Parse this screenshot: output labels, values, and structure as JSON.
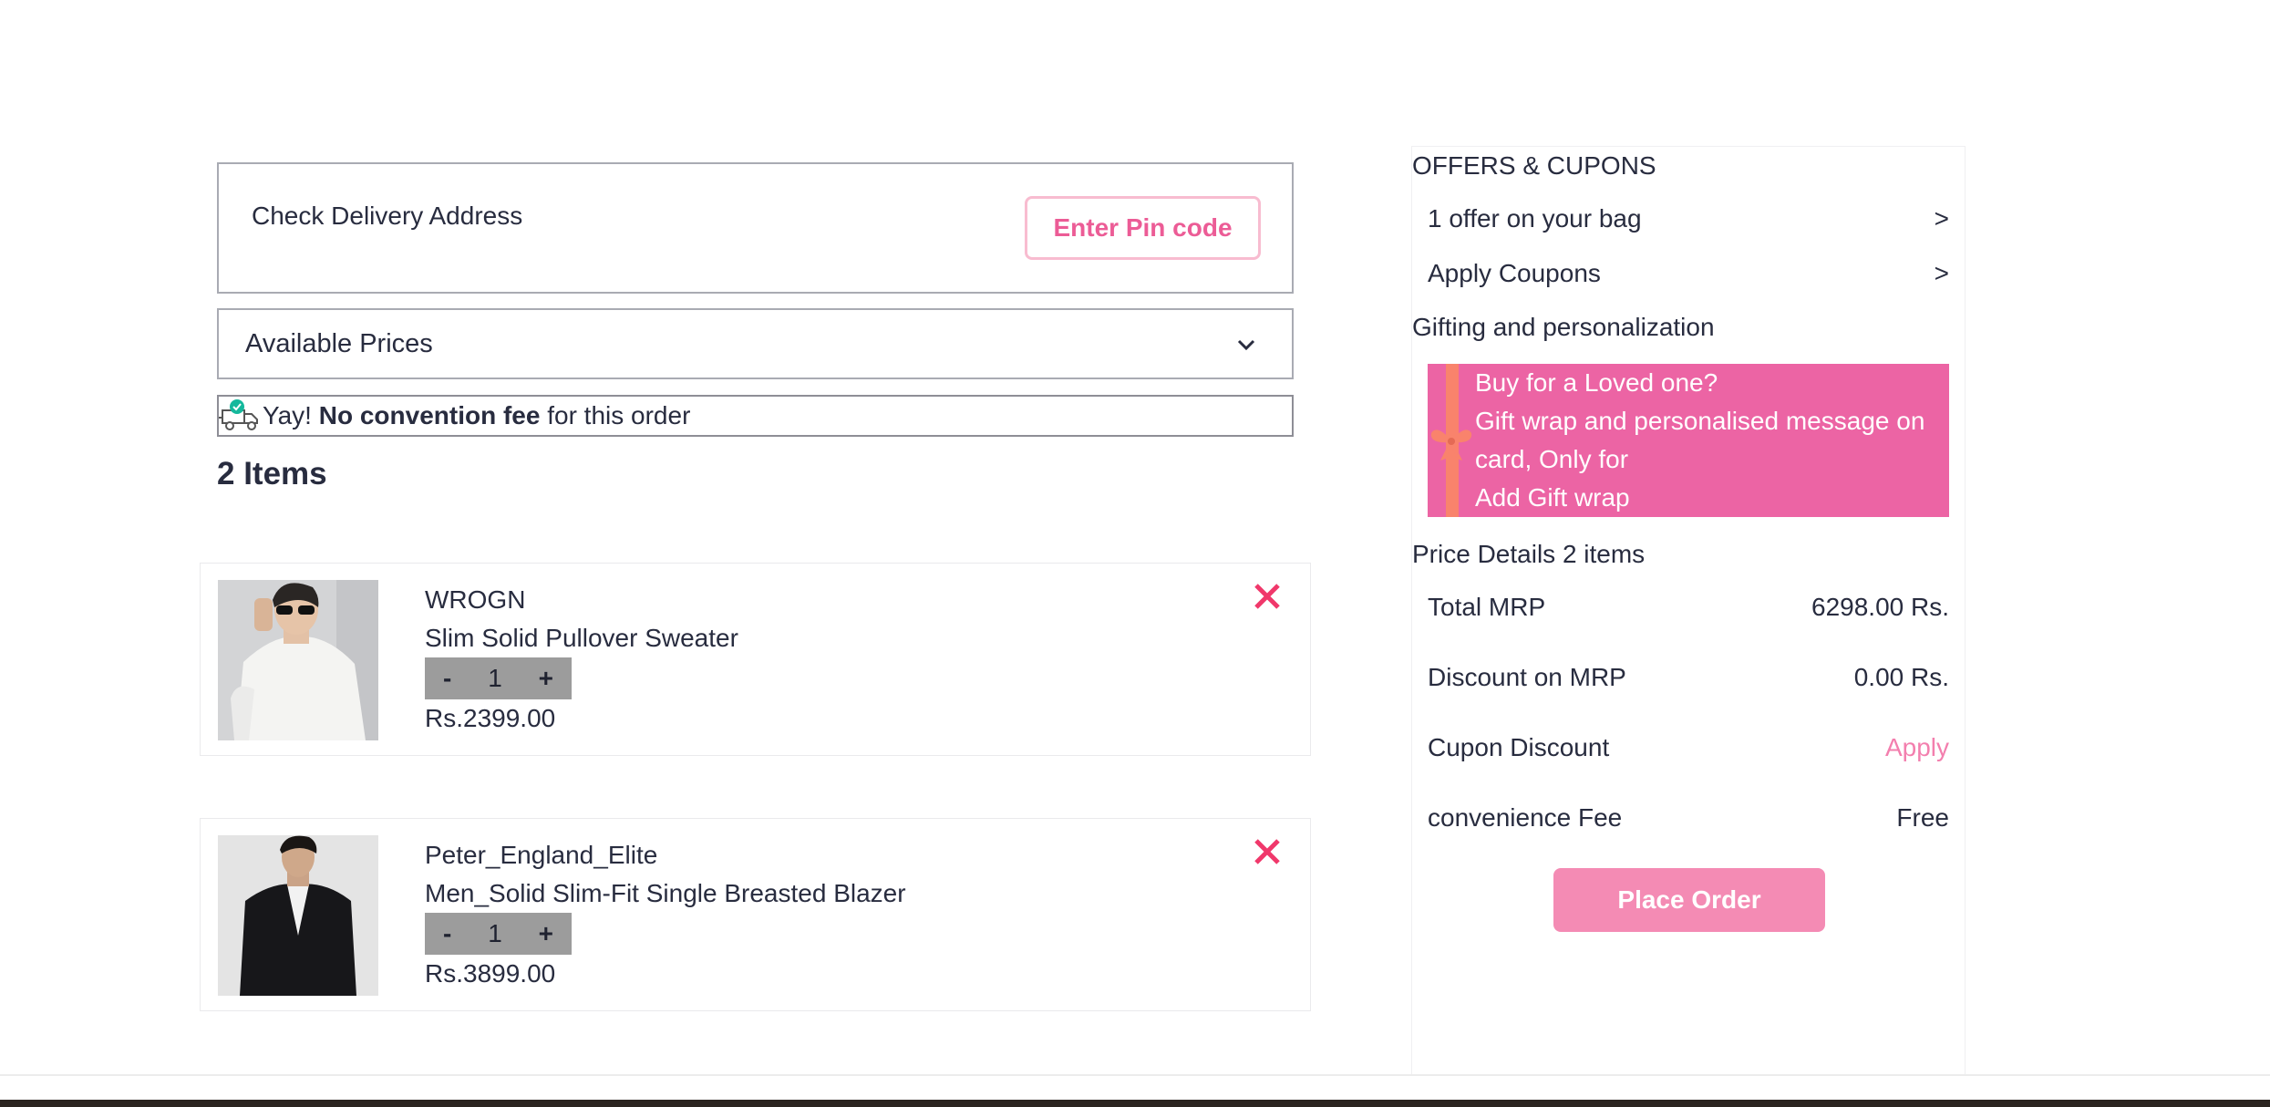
{
  "delivery": {
    "label": "Check Delivery Address",
    "pin_button": "Enter Pin code"
  },
  "available_prices": {
    "label": "Available Prices"
  },
  "fee_notice": {
    "prefix": "Yay! ",
    "bold": "No convention fee",
    "suffix": " for this order"
  },
  "items_count": "2 Items",
  "items": [
    {
      "brand": "WROGN",
      "name": "Slim Solid Pullover Sweater",
      "qty_minus": "-",
      "qty": "1",
      "qty_plus": "+",
      "price": "Rs.2399.00"
    },
    {
      "brand": "Peter_England_Elite",
      "name": "Men_Solid Slim-Fit Single Breasted Blazer",
      "qty_minus": "-",
      "qty": "1",
      "qty_plus": "+",
      "price": "Rs.3899.00"
    }
  ],
  "sidebar": {
    "offers_heading": "OFFERS & CUPONS",
    "offer_row": {
      "label": "1 offer on your bag",
      "arrow": ">"
    },
    "coupon_row": {
      "label": "Apply Coupons",
      "arrow": ">"
    },
    "gifting_heading": "Gifting and personalization",
    "gift": {
      "line1": "Buy for a Loved one?",
      "line2": "Gift wrap and personalised message on card, Only for",
      "line3": "Add Gift wrap"
    },
    "price_heading": "Price Details 2 items",
    "price_rows": [
      {
        "label": "Total MRP",
        "value": "6298.00 Rs."
      },
      {
        "label": "Discount on MRP",
        "value": "0.00 Rs."
      },
      {
        "label": "Cupon Discount",
        "value": "Apply"
      },
      {
        "label": "convenience Fee",
        "value": "Free"
      }
    ],
    "place_order": "Place Order"
  },
  "colors": {
    "accent": "#ec5c96",
    "gift_bg": "#ec64a4",
    "remove": "#f0386b",
    "place_order_bg": "#f48bb4"
  }
}
